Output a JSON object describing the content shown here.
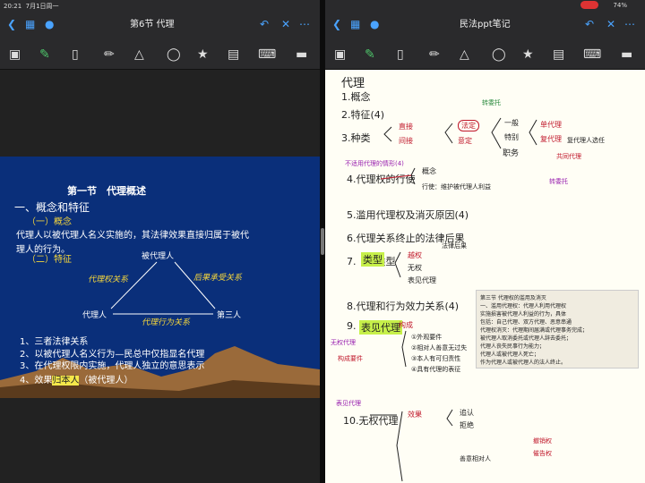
{
  "left": {
    "status": {
      "time": "20:21",
      "date": "7月1日周一"
    },
    "title": "第6节 代理",
    "slide": {
      "heading": "第一节　代理概述",
      "section1": "一、概念和特征",
      "sub1": "（一）概念",
      "definition_line1": "代理人以被代理人名义实施的，其法律效果直接归属于被代",
      "definition_line2": "理人的行为。",
      "sub2": "（二）特征",
      "diagram": {
        "top": "被代理人",
        "left": "代理人",
        "right": "第三人",
        "edge_left": "代理权关系",
        "edge_right": "后果承受关系",
        "edge_bottom": "代理行为关系"
      },
      "points": [
        "1、三者法律关系",
        "2、以被代理人名义行为—民总中仅指显名代理",
        "3、在代理权限内实施，代理人独立的意思表示"
      ],
      "point4_prefix": "4、效果",
      "point4_highlight": "归本人",
      "point4_suffix": "（被代理人）"
    }
  },
  "right": {
    "status": {
      "battery": "74%"
    },
    "title": "民法ppt笔记",
    "notes": {
      "h": "代理",
      "items": [
        "1.概念",
        "2.特征(4)",
        "3.种类",
        "4.代理权的行使",
        "5.滥用代理权及消灭原因(4)",
        "6.代理关系终止的法律后果",
        "7.　　类型",
        "8.代理和行为效力关系(4)",
        "9.",
        "10.无权代理"
      ],
      "n3_a": "直接",
      "n3_b": "间接",
      "n3_c": "法定",
      "n3_d": "意定",
      "n3_e": "一般",
      "n3_f": "特别",
      "n3_g": "职务",
      "n3_h": "单代理",
      "n3_i": "复代理",
      "n3_j": "共同代理",
      "n3_k": "转委托",
      "n3_l": "复代理人选任",
      "n4_note": "不适用代理的情形(4)",
      "n4_a": "概念",
      "n4_b": "行使：维护被代理人利益",
      "n6_a": "法律后果",
      "n7_a": "类型",
      "n7_b": "越权",
      "n7_c": "无权",
      "n7_d": "表见代理",
      "n9_a": "表见代理",
      "n9_b": "构成",
      "n9_c": "①外观要件",
      "n9_d": "②相对人善意无过失",
      "n9_e": "③本人有可归责性",
      "n9_f": "④具有代理的表征",
      "n9_g": "构成要件",
      "n10_a": "效果",
      "n10_b": "追认",
      "n10_c": "拒绝",
      "n10_d": "撤销权",
      "n10_e": "善意相对人",
      "n10_f": "催告权",
      "side_a": "无权代理",
      "side_b": "表见代理"
    },
    "excerpt": "第三节 代理权的滥用及消灭\n一、滥用代理权：代理人利用代理权\n实施损害被代理人利益的行为，具体\n包括：自己代理、双方代理、恶意串通\n代理权消灭：代理期间届满或代理事务完成；\n被代理人取消委托或代理人辞去委托；\n代理人丧失民事行为能力；\n代理人或被代理人死亡；\n作为代理人或被代理人的法人终止。"
  },
  "colors": {
    "slide_bg": "#0a2f7a",
    "note_red": "#c0182b",
    "highlight_yellow": "#f5d63c",
    "note_purple": "#9a23b0"
  }
}
